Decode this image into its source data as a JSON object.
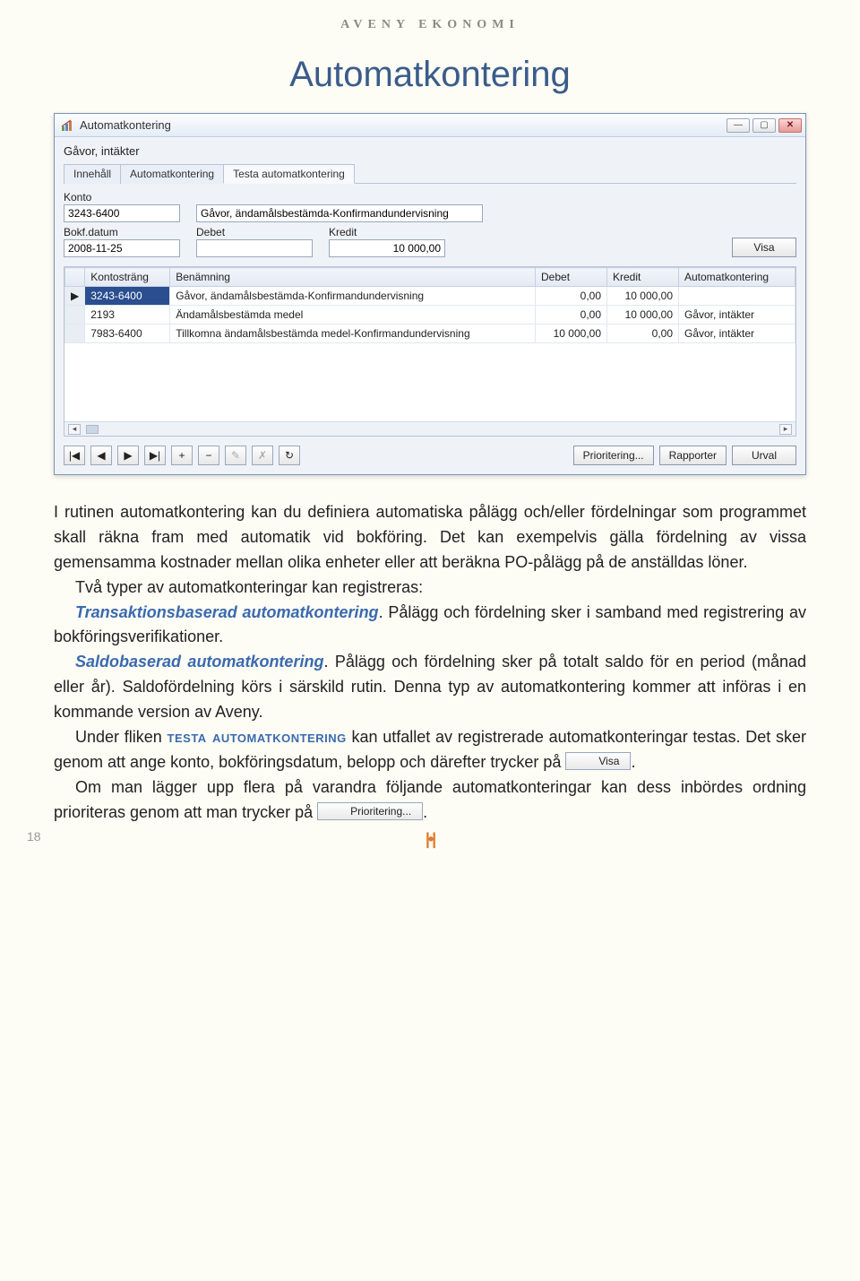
{
  "header": "AVENY EKONOMI",
  "title": "Automatkontering",
  "window": {
    "title": "Automatkontering",
    "context": "Gåvor, intäkter",
    "tabs": [
      "Innehåll",
      "Automatkontering",
      "Testa automatkontering"
    ],
    "activeTab": 2,
    "form": {
      "konto_label": "Konto",
      "konto_value": "3243-6400",
      "konto_desc": "Gåvor, ändamålsbestämda-Konfirmandundervisning",
      "bokf_label": "Bokf.datum",
      "bokf_value": "2008-11-25",
      "debet_label": "Debet",
      "debet_value": "",
      "kredit_label": "Kredit",
      "kredit_value": "10 000,00",
      "visa_btn": "Visa"
    },
    "grid": {
      "headers": [
        "Kontosträng",
        "Benämning",
        "Debet",
        "Kredit",
        "Automatkontering"
      ],
      "rows": [
        {
          "marker": "▶",
          "sel": true,
          "k": "3243-6400",
          "b": "Gåvor, ändamålsbestämda-Konfirmandundervisning",
          "d": "0,00",
          "kr": "10 000,00",
          "a": ""
        },
        {
          "marker": "",
          "sel": false,
          "k": "2193",
          "b": "Ändamålsbestämda medel",
          "d": "0,00",
          "kr": "10 000,00",
          "a": "Gåvor, intäkter"
        },
        {
          "marker": "",
          "sel": false,
          "k": "7983-6400",
          "b": "Tillkomna ändamålsbestämda medel-Konfirmandundervisning",
          "d": "10 000,00",
          "kr": "0,00",
          "a": "Gåvor, intäkter"
        }
      ]
    },
    "bottom_buttons": {
      "prioritering": "Prioritering...",
      "rapporter": "Rapporter",
      "urval": "Urval"
    },
    "nav": {
      "first": "|◀",
      "prev": "◀",
      "next": "▶",
      "last": "▶|",
      "add": "+",
      "del": "−",
      "edit": "✎",
      "cancel": "✗",
      "refresh": "↻"
    }
  },
  "body": {
    "p1a": "I rutinen automatkontering kan du definiera automatiska pålägg och/eller fördelningar som programmet skall räkna fram med automatik vid bokföring. Det kan exempelvis gälla fördelning av vissa gemensamma kostnader mellan olika enheter eller att beräkna PO-pålägg på de anställdas löner.",
    "p2_intro": "Två typer av automatkonteringar kan registreras:",
    "kw1": "Transaktionsbaserad automatkontering",
    "p2_rest": ". Pålägg och fördelning sker i samband med registrering av bokföringsverifikationer.",
    "kw2": "Saldobaserad automatkontering",
    "p3_rest": ". Pålägg och fördelning sker på totalt saldo för en period (månad eller år). Saldofördelning körs i särskild rutin. Denna typ av automatkontering kommer att införas i en kommande version av Aveny.",
    "p4_a": "Under fliken ",
    "p4_caps": "testa automatkontering",
    "p4_b": " kan utfallet av registrerade automatkonteringar testas. Det sker genom att ange konto, bokföringsdatum, belopp och därefter trycker på ",
    "p4_btn": "Visa",
    "p4_end": ".",
    "p5_a": "Om man lägger upp flera på varandra följande automatkonteringar kan dess inbördes ordning prioriteras genom att man trycker på ",
    "p5_btn": "Prioritering...",
    "p5_end": "."
  },
  "page_number": "18"
}
